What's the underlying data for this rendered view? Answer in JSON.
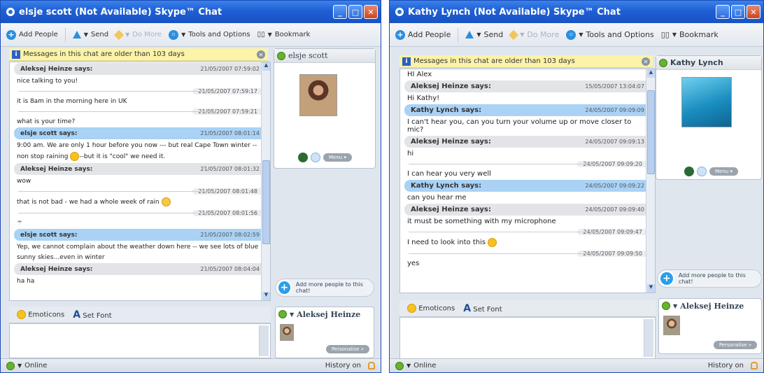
{
  "toolbar": {
    "add_people": "Add People",
    "send": "Send",
    "do_more": "Do More",
    "tools": "Tools and Options",
    "bookmark": "Bookmark"
  },
  "left_window": {
    "title": "elsje scott (Not Available) Skype™ Chat",
    "notice": "Messages in this chat are older than 103 days",
    "contact_name": "elsje scott",
    "menu_label": "Menu",
    "add_more": "Add more people to this chat!",
    "me_name": "Aleksej Heinze",
    "personalise": "Personalise",
    "emoticons": "Emoticons",
    "set_font": "Set Font",
    "status": "Online",
    "history": "History on",
    "messages": {
      "h1_name": "Aleksej Heinze says:",
      "h1_time": "21/05/2007 07:59:02",
      "l1": "nice talking to you!",
      "s1": "21/05/2007 07:59:17",
      "l2": "it is 8am in the morning here in UK",
      "s2": "21/05/2007 07:59:21",
      "l3": "what is your time?",
      "h2_name": "elsje scott says:",
      "h2_time": "21/05/2007 08:01:14",
      "l4": "9:00 am.  We are only 1 hour before you now --- but real Cape Town winter --",
      "l5a": "non stop raining",
      "l5b": "--but it is \"cool\" we need it.",
      "h3_name": "Aleksej Heinze says:",
      "h3_time": "21/05/2007 08:01:32",
      "l6": "wow",
      "s3": "21/05/2007 08:01:48",
      "l7": "that is not bad - we had a whole week of rain",
      "s4": "21/05/2007 08:01:56",
      "h4_name": "elsje scott says:",
      "h4_time": "21/05/2007 08:02:59",
      "l8": "Yep,  we cannot complain about the weather down here -- we see lots of blue",
      "l9": "sunny skies...even in winter",
      "h5_name": "Aleksej Heinze says:",
      "h5_time": "21/05/2007 08:04:04",
      "l10": "ha ha"
    }
  },
  "right_window": {
    "title": "Kathy Lynch (Not Available) Skype™ Chat",
    "notice": "Messages in this chat are older than 103 days",
    "contact_name": "Kathy Lynch",
    "menu_label": "Menu",
    "add_more": "Add more people to this chat!",
    "me_name": "Aleksej Heinze",
    "personalise": "Personalise",
    "emoticons": "Emoticons",
    "set_font": "Set Font",
    "status": "Online",
    "history": "History on",
    "messages": {
      "l0": "HI Alex",
      "h1_name": "Aleksej Heinze says:",
      "h1_time": "15/05/2007 13:04:07",
      "l1": "Hi Kathy!",
      "h2_name": "Kathy Lynch says:",
      "h2_time": "24/05/2007 09:09:09",
      "l2": "I can't hear you, can you turn your volume up or move closer to mic?",
      "h3_name": "Aleksej Heinze says:",
      "h3_time": "24/05/2007 09:09:13",
      "l3": "hi",
      "s1": "24/05/2007 09:09:20",
      "l4": "I can hear you very well",
      "h4_name": "Kathy Lynch says:",
      "h4_time": "24/05/2007 09:09:22",
      "l5": "can you hear me",
      "h5_name": "Aleksej Heinze says:",
      "h5_time": "24/05/2007 09:09:40",
      "l6": "it must be something with my microphone",
      "s2": "24/05/2007 09:09:47",
      "l7": "I need to look into this",
      "s3": "24/05/2007 09:09:50",
      "l8": "yes"
    }
  }
}
